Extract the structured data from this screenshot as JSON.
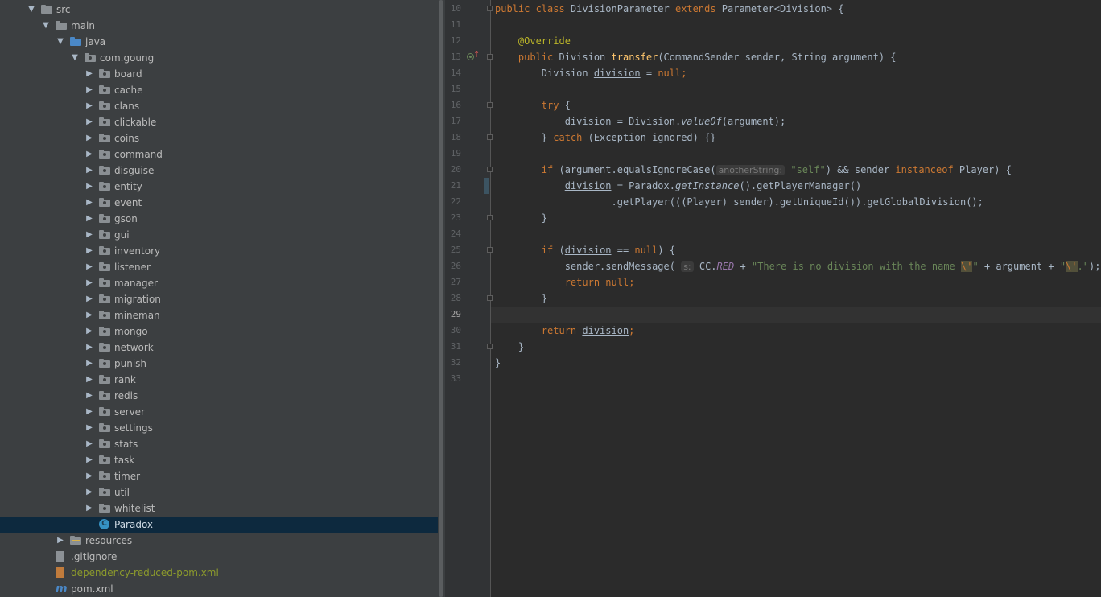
{
  "project_tree": [
    {
      "label": "src",
      "depth": 0,
      "arrow": "expanded",
      "icon": "folder"
    },
    {
      "label": "main",
      "depth": 1,
      "arrow": "expanded",
      "icon": "folder"
    },
    {
      "label": "java",
      "depth": 2,
      "arrow": "expanded",
      "icon": "source-folder"
    },
    {
      "label": "com.goung",
      "depth": 3,
      "arrow": "expanded",
      "icon": "package"
    },
    {
      "label": "board",
      "depth": 4,
      "arrow": "collapsed",
      "icon": "package"
    },
    {
      "label": "cache",
      "depth": 4,
      "arrow": "collapsed",
      "icon": "package"
    },
    {
      "label": "clans",
      "depth": 4,
      "arrow": "collapsed",
      "icon": "package"
    },
    {
      "label": "clickable",
      "depth": 4,
      "arrow": "collapsed",
      "icon": "package"
    },
    {
      "label": "coins",
      "depth": 4,
      "arrow": "collapsed",
      "icon": "package"
    },
    {
      "label": "command",
      "depth": 4,
      "arrow": "collapsed",
      "icon": "package"
    },
    {
      "label": "disguise",
      "depth": 4,
      "arrow": "collapsed",
      "icon": "package"
    },
    {
      "label": "entity",
      "depth": 4,
      "arrow": "collapsed",
      "icon": "package"
    },
    {
      "label": "event",
      "depth": 4,
      "arrow": "collapsed",
      "icon": "package"
    },
    {
      "label": "gson",
      "depth": 4,
      "arrow": "collapsed",
      "icon": "package"
    },
    {
      "label": "gui",
      "depth": 4,
      "arrow": "collapsed",
      "icon": "package"
    },
    {
      "label": "inventory",
      "depth": 4,
      "arrow": "collapsed",
      "icon": "package"
    },
    {
      "label": "listener",
      "depth": 4,
      "arrow": "collapsed",
      "icon": "package"
    },
    {
      "label": "manager",
      "depth": 4,
      "arrow": "collapsed",
      "icon": "package"
    },
    {
      "label": "migration",
      "depth": 4,
      "arrow": "collapsed",
      "icon": "package"
    },
    {
      "label": "mineman",
      "depth": 4,
      "arrow": "collapsed",
      "icon": "package"
    },
    {
      "label": "mongo",
      "depth": 4,
      "arrow": "collapsed",
      "icon": "package"
    },
    {
      "label": "network",
      "depth": 4,
      "arrow": "collapsed",
      "icon": "package"
    },
    {
      "label": "punish",
      "depth": 4,
      "arrow": "collapsed",
      "icon": "package"
    },
    {
      "label": "rank",
      "depth": 4,
      "arrow": "collapsed",
      "icon": "package"
    },
    {
      "label": "redis",
      "depth": 4,
      "arrow": "collapsed",
      "icon": "package"
    },
    {
      "label": "server",
      "depth": 4,
      "arrow": "collapsed",
      "icon": "package"
    },
    {
      "label": "settings",
      "depth": 4,
      "arrow": "collapsed",
      "icon": "package"
    },
    {
      "label": "stats",
      "depth": 4,
      "arrow": "collapsed",
      "icon": "package"
    },
    {
      "label": "task",
      "depth": 4,
      "arrow": "collapsed",
      "icon": "package"
    },
    {
      "label": "timer",
      "depth": 4,
      "arrow": "collapsed",
      "icon": "package"
    },
    {
      "label": "util",
      "depth": 4,
      "arrow": "collapsed",
      "icon": "package"
    },
    {
      "label": "whitelist",
      "depth": 4,
      "arrow": "collapsed",
      "icon": "package"
    },
    {
      "label": "Paradox",
      "depth": 4,
      "arrow": "none",
      "icon": "class",
      "selected": true
    },
    {
      "label": "resources",
      "depth": 2,
      "arrow": "collapsed",
      "icon": "resources-folder"
    },
    {
      "label": ".gitignore",
      "depth": 1,
      "arrow": "none",
      "icon": "file"
    },
    {
      "label": "dependency-reduced-pom.xml",
      "depth": 1,
      "arrow": "none",
      "icon": "xml-file",
      "ignored": true
    },
    {
      "label": "pom.xml",
      "depth": 1,
      "arrow": "none",
      "icon": "maven"
    }
  ],
  "class_icon_letter": "C",
  "editor": {
    "current_line": 29,
    "line_numbers": [
      "10",
      "11",
      "12",
      "13",
      "14",
      "15",
      "16",
      "17",
      "18",
      "19",
      "20",
      "21",
      "22",
      "23",
      "24",
      "25",
      "26",
      "27",
      "28",
      "29",
      "30",
      "31",
      "32",
      "33"
    ],
    "fold_lines": [
      10,
      13,
      16,
      18,
      20,
      23,
      25,
      28,
      31
    ],
    "lines": [
      [
        [
          "public class ",
          "kw"
        ],
        [
          "DivisionParameter ",
          ""
        ],
        [
          "extends ",
          "kw"
        ],
        [
          "Parameter<Division> {",
          ""
        ]
      ],
      [],
      [
        [
          "    ",
          ""
        ],
        [
          "@Override",
          "ann"
        ]
      ],
      [
        [
          "    ",
          ""
        ],
        [
          "public ",
          "kw"
        ],
        [
          "Division ",
          ""
        ],
        [
          "transfer",
          "fn"
        ],
        [
          "(CommandSender sender, String argument) {",
          ""
        ]
      ],
      [
        [
          "        Division ",
          ""
        ],
        [
          "division",
          "var"
        ],
        [
          " = ",
          ""
        ],
        [
          "null",
          "kw"
        ],
        [
          ";",
          "kw"
        ]
      ],
      [],
      [
        [
          "        ",
          ""
        ],
        [
          "try ",
          "kw"
        ],
        [
          "{",
          ""
        ]
      ],
      [
        [
          "            ",
          ""
        ],
        [
          "division",
          "var"
        ],
        [
          " = Division.",
          ""
        ],
        [
          "valueOf",
          "it"
        ],
        [
          "(argument);",
          ""
        ]
      ],
      [
        [
          "        } ",
          ""
        ],
        [
          "catch ",
          "kw"
        ],
        [
          "(Exception ignored) {}",
          ""
        ]
      ],
      [],
      [
        [
          "        ",
          ""
        ],
        [
          "if ",
          "kw"
        ],
        [
          "(argument.equalsIgnoreCase(",
          ""
        ],
        [
          "anotherString:",
          "hint"
        ],
        [
          " ",
          ""
        ],
        [
          "\"self\"",
          "str"
        ],
        [
          ") && sender ",
          ""
        ],
        [
          "instanceof ",
          "kw"
        ],
        [
          "Player) {",
          ""
        ]
      ],
      [
        [
          "            ",
          ""
        ],
        [
          "division",
          "var"
        ],
        [
          " = Paradox.",
          ""
        ],
        [
          "getInstance",
          "it"
        ],
        [
          "().getPlayerManager()",
          ""
        ]
      ],
      [
        [
          "                    .getPlayer(((Player) sender).getUniqueId()).getGlobalDivision();",
          ""
        ]
      ],
      [
        [
          "        }",
          ""
        ]
      ],
      [],
      [
        [
          "        ",
          ""
        ],
        [
          "if ",
          "kw"
        ],
        [
          "(",
          ""
        ],
        [
          "division",
          "var"
        ],
        [
          " == ",
          ""
        ],
        [
          "null",
          "kw"
        ],
        [
          ") {",
          ""
        ]
      ],
      [
        [
          "            sender.sendMessage( ",
          ""
        ],
        [
          "s:",
          "hint"
        ],
        [
          " CC.",
          ""
        ],
        [
          "RED",
          "cst"
        ],
        [
          " + ",
          ""
        ],
        [
          "\"There is no division with the name ",
          "str"
        ],
        [
          "\\'",
          "esc"
        ],
        [
          "\"",
          "str"
        ],
        [
          " + argument + ",
          ""
        ],
        [
          "\"",
          "str"
        ],
        [
          "\\'",
          "esc"
        ],
        [
          ".\"",
          "str"
        ],
        [
          ");",
          ""
        ]
      ],
      [
        [
          "            ",
          ""
        ],
        [
          "return null",
          "kw"
        ],
        [
          ";",
          "kw"
        ]
      ],
      [
        [
          "        }",
          ""
        ]
      ],
      [],
      [
        [
          "        ",
          ""
        ],
        [
          "return ",
          "kw"
        ],
        [
          "division",
          "var"
        ],
        [
          ";",
          "kw"
        ]
      ],
      [
        [
          "    }",
          ""
        ]
      ],
      [
        [
          "}",
          ""
        ]
      ],
      []
    ]
  }
}
